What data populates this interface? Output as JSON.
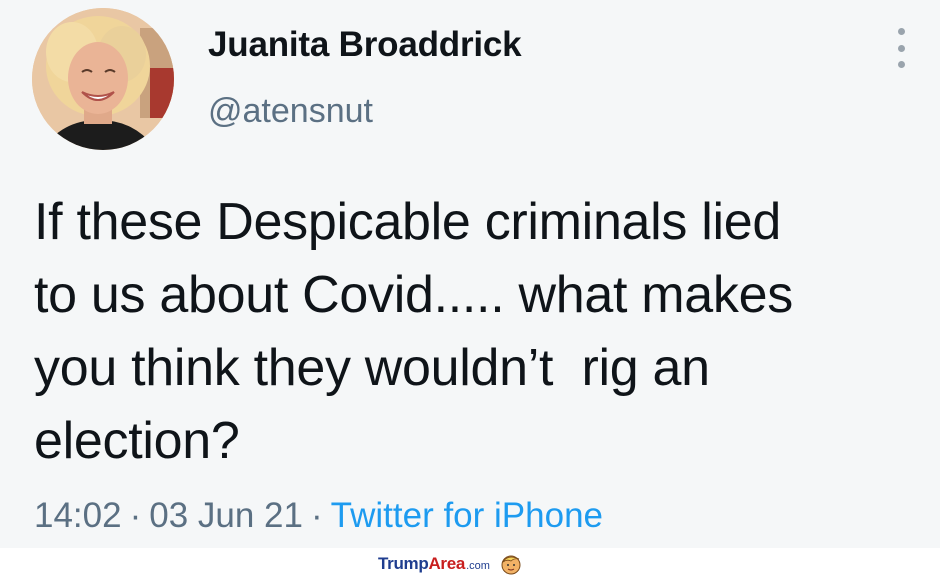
{
  "tweet": {
    "display_name": "Juanita Broaddrick",
    "handle": "@atensnut",
    "text": "If these Despicable criminals lied\nto us about Covid..... what makes\nyou think they wouldn’t  rig an\nelection?",
    "time": "14:02",
    "separator": "·",
    "date": "03 Jun 21",
    "source": "Twitter for iPhone",
    "avatar_icon": "profile-photo",
    "more_icon": "vertical-dots-icon"
  },
  "watermark": {
    "part1": "Trump",
    "part2": "Area",
    "part3": ".com",
    "logo_icon": "trump-face-icon"
  },
  "colors": {
    "background": "#f5f7f8",
    "text": "#0f1419",
    "muted": "#5b7083",
    "link": "#1d9bf0"
  }
}
